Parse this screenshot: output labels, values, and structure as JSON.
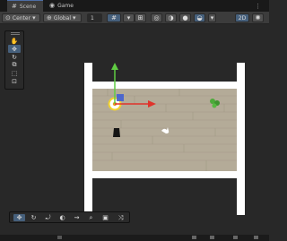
{
  "tabs": [
    {
      "label": "Scene",
      "icon": "scene-hash-icon",
      "active": true
    },
    {
      "label": "Game",
      "icon": "game-controller-icon",
      "active": false
    }
  ],
  "toolbar": {
    "pivot": "Center",
    "space": "Global",
    "snap_value": "1",
    "mode_2d": "2D"
  },
  "colors": {
    "accent": "#46607c",
    "gizmo_x": "#e0332b",
    "gizmo_y": "#5fcc42",
    "floor": "#b4ab98"
  },
  "scene": {
    "objects": [
      "left-wall",
      "right-wall",
      "top-wall",
      "bottom-wall",
      "floor",
      "player-disc",
      "cone-prop",
      "dove-sprite",
      "plant-sprite",
      "move-gizmo"
    ]
  },
  "tools": [
    "hand-icon",
    "move-icon",
    "rotate-icon",
    "scale-icon",
    "rect-icon",
    "transform-icon",
    "custom-tool-icon"
  ],
  "overlay_tools": [
    "move-tool-icon",
    "rotate-tool-icon",
    "orbit-icon",
    "sphere-icon",
    "path-icon",
    "zoom-icon",
    "camera-icon",
    "shuffle-icon"
  ]
}
